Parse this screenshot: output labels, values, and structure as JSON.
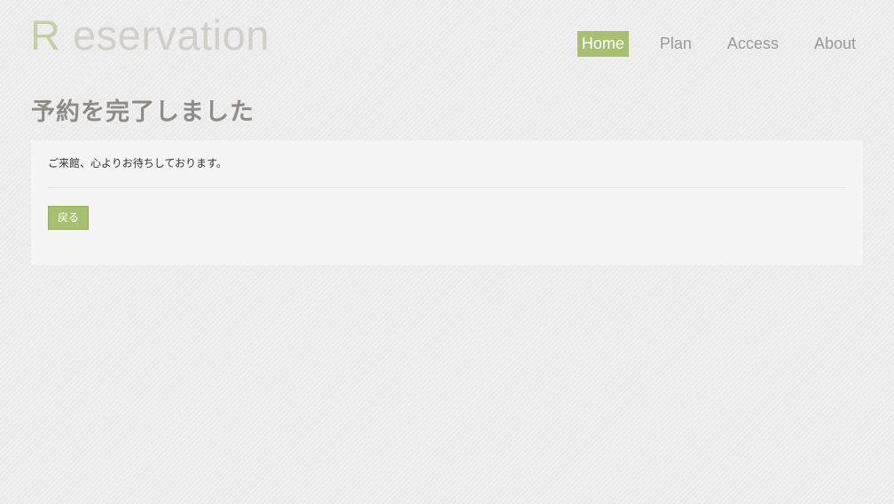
{
  "header": {
    "logo_initial": "R",
    "logo_rest": " eservation"
  },
  "nav": {
    "items": [
      {
        "label": "Home",
        "active": true
      },
      {
        "label": "Plan",
        "active": false
      },
      {
        "label": "Access",
        "active": false
      },
      {
        "label": "About",
        "active": false
      }
    ]
  },
  "main": {
    "title": "予約を完了しました",
    "message": "ご来館、心よりお待ちしております。",
    "back_label": "戻る"
  },
  "colors": {
    "accent": "#a7c070",
    "title": "#8e8b86",
    "background": "#ebebeb",
    "panel": "#f4f4f4"
  }
}
